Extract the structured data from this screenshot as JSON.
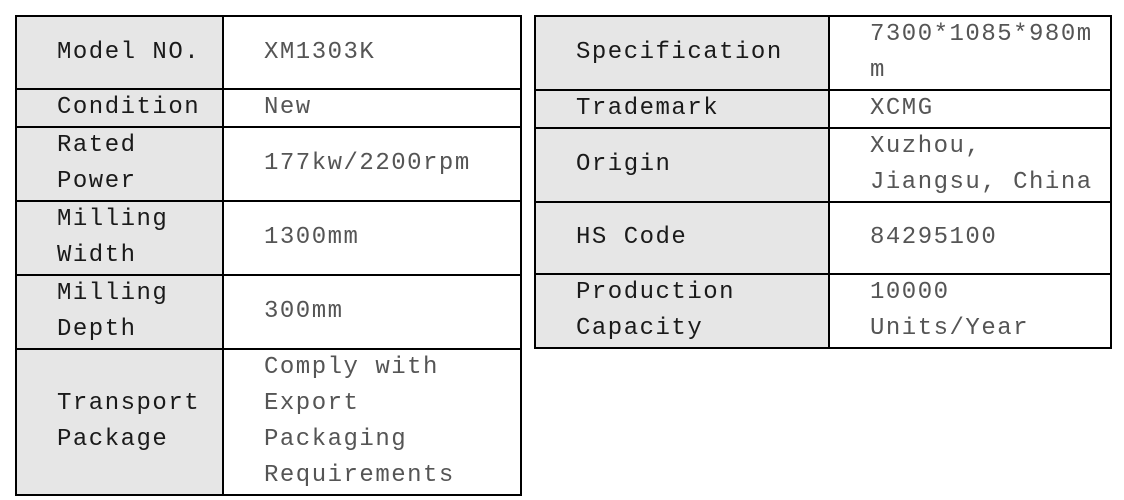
{
  "left_table": {
    "rows": [
      {
        "label": [
          "Model NO."
        ],
        "value": [
          "XM1303K"
        ]
      },
      {
        "label": [
          "Condition"
        ],
        "value": [
          "New"
        ]
      },
      {
        "label": [
          "Rated",
          "Power"
        ],
        "value": [
          "177kw/2200rpm"
        ]
      },
      {
        "label": [
          "Milling",
          "Width"
        ],
        "value": [
          "1300mm"
        ]
      },
      {
        "label": [
          "Milling",
          "Depth"
        ],
        "value": [
          "300mm"
        ]
      },
      {
        "label": [
          "Transport",
          "Package"
        ],
        "value": [
          "Comply with",
          "Export",
          "Packaging",
          "Requirements"
        ]
      }
    ]
  },
  "right_table": {
    "rows": [
      {
        "label": [
          "Specification"
        ],
        "value": [
          "7300*1085*980m",
          "m"
        ]
      },
      {
        "label": [
          "Trademark"
        ],
        "value": [
          "XCMG"
        ]
      },
      {
        "label": [
          "Origin"
        ],
        "value": [
          "Xuzhou,",
          "Jiangsu, China"
        ]
      },
      {
        "label": [
          "HS Code"
        ],
        "value": [
          "84295100"
        ]
      },
      {
        "label": [
          "Production",
          "Capacity"
        ],
        "value": [
          "10000",
          "Units/Year"
        ]
      }
    ]
  }
}
